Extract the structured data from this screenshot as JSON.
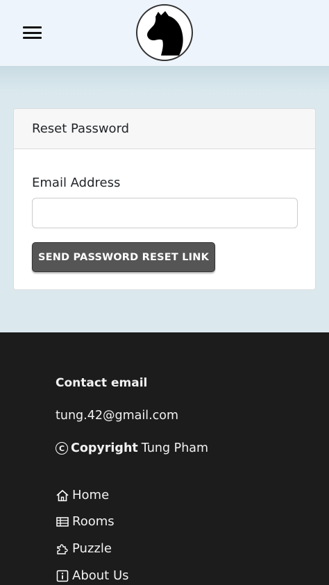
{
  "header": {
    "menu_icon": "hamburger-icon",
    "logo_icon": "horse-head-icon"
  },
  "card": {
    "title": "Reset Password",
    "email_label": "Email Address",
    "email_value": "",
    "email_placeholder": "",
    "submit_label": "SEND PASSWORD RESET LINK"
  },
  "footer": {
    "contact_heading": "Contact email",
    "email": "tung.42@gmail.com",
    "copyright_word": "Copyright",
    "copyright_name": "Tung Pham",
    "links": [
      {
        "label": "Home",
        "icon": "home-icon"
      },
      {
        "label": "Rooms",
        "icon": "table-icon"
      },
      {
        "label": "Puzzle",
        "icon": "puzzle-icon"
      },
      {
        "label": "About Us",
        "icon": "info-icon"
      }
    ]
  },
  "colors": {
    "page_bg": "#dbe9ee",
    "navbar_bg": "#eef4fb",
    "button_bg": "#555555",
    "footer_bg": "#1c1c1c"
  }
}
